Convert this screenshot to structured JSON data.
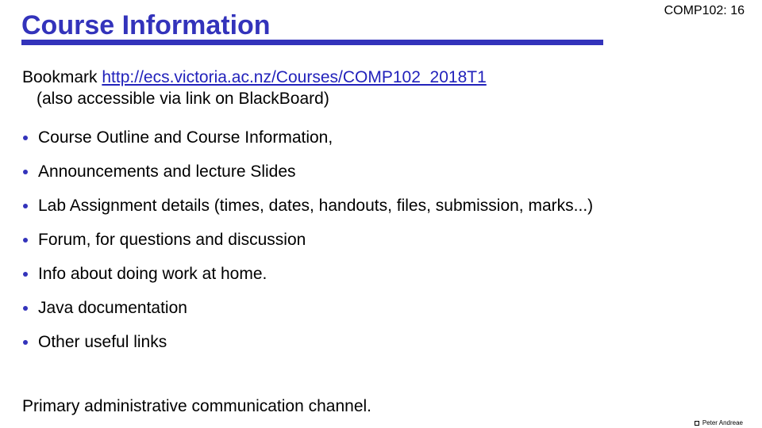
{
  "header": {
    "title": "Course Information",
    "slide_label": "COMP102: 16",
    "accent_color": "#3333bb"
  },
  "bookmark": {
    "prefix": "Bookmark ",
    "url": "http://ecs.victoria.ac.nz/Courses/COMP102_2018T1",
    "note": "(also accessible via link on BlackBoard)"
  },
  "bullets": [
    "Course Outline  and Course Information,",
    "Announcements and lecture Slides",
    "Lab Assignment details (times, dates, handouts, files, submission, marks...)",
    "Forum, for questions and discussion",
    "Info about doing work at home.",
    "Java documentation",
    "Other useful links"
  ],
  "footer": {
    "statement": "Primary administrative communication channel.",
    "copyright": "Peter Andreae",
    "copyright_icon": "copyright-icon"
  }
}
